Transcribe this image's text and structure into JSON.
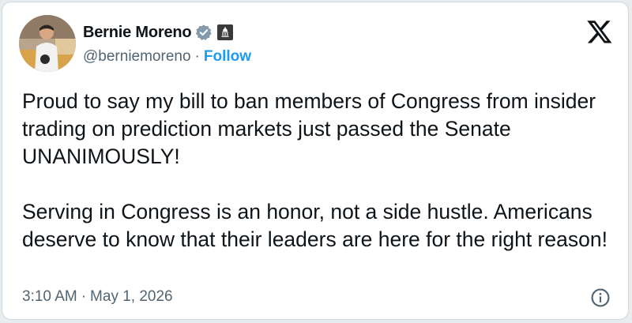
{
  "author": {
    "display_name": "Bernie Moreno",
    "handle": "@berniemoreno",
    "separator": "·",
    "follow_label": "Follow",
    "verified_icon": "verified-badge-icon",
    "affiliation_icon": "government-building-icon"
  },
  "tweet": {
    "paragraph_1": "Proud to say my bill to ban members of Congress from insider trading on prediction markets just passed the Senate UNANIMOUSLY!",
    "paragraph_2": "Serving in Congress is an honor, not a side hustle. Americans deserve to know that their leaders are here for the right reason!"
  },
  "meta": {
    "time": "3:10 AM",
    "separator": "·",
    "date": "May 1, 2026"
  },
  "colors": {
    "link": "#1d9bf0",
    "text": "#0f1419",
    "secondary": "#536471",
    "verified": "#829aab"
  }
}
